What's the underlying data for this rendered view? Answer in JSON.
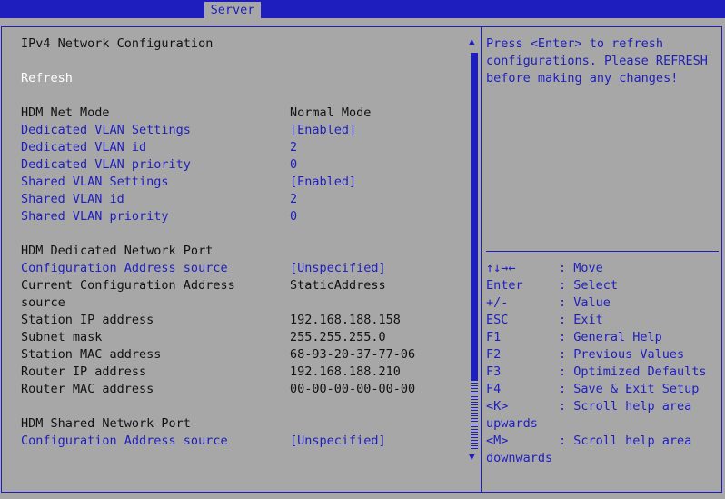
{
  "header": {
    "tab": "Server"
  },
  "page": {
    "title": "IPv4 Network Configuration",
    "refresh": "Refresh"
  },
  "settings": [
    {
      "label": "HDM Net Mode",
      "value": "Normal Mode",
      "selectable": false
    },
    {
      "label": "Dedicated VLAN Settings",
      "value": "[Enabled]",
      "selectable": true
    },
    {
      "label": "Dedicated VLAN id",
      "value": "2",
      "selectable": true
    },
    {
      "label": "Dedicated VLAN priority",
      "value": "0",
      "selectable": true
    },
    {
      "label": "Shared VLAN Settings",
      "value": "[Enabled]",
      "selectable": true
    },
    {
      "label": "Shared VLAN id",
      "value": "2",
      "selectable": true
    },
    {
      "label": "Shared VLAN priority",
      "value": "0",
      "selectable": true
    }
  ],
  "dedicated": {
    "heading": "HDM Dedicated Network Port",
    "config_source_label": "Configuration Address source",
    "config_source_value": "[Unspecified]",
    "current_label_1": "Current Configuration Address",
    "current_label_2": "source",
    "current_value": "StaticAddress",
    "rows": [
      {
        "label": "Station IP address",
        "value": "192.168.188.158"
      },
      {
        "label": "Subnet mask",
        "value": "255.255.255.0"
      },
      {
        "label": "Station MAC address",
        "value": "68-93-20-37-77-06"
      },
      {
        "label": "Router IP address",
        "value": "192.168.188.210"
      },
      {
        "label": "Router MAC address",
        "value": "00-00-00-00-00-00"
      }
    ]
  },
  "shared": {
    "heading": "HDM Shared Network Port",
    "config_source_label": "Configuration Address source",
    "config_source_value": "[Unspecified]"
  },
  "help": {
    "lines": [
      "Press <Enter> to refresh",
      "configurations. Please REFRESH",
      "before making any changes!"
    ]
  },
  "keys": [
    {
      "key": "↑↓→←",
      "desc": ": Move"
    },
    {
      "key": "Enter",
      "desc": ": Select"
    },
    {
      "key": "+/-",
      "desc": ": Value"
    },
    {
      "key": "ESC",
      "desc": ": Exit"
    },
    {
      "key": "F1",
      "desc": ": General Help"
    },
    {
      "key": "F2",
      "desc": ": Previous Values"
    },
    {
      "key": "F3",
      "desc": ": Optimized Defaults"
    },
    {
      "key": "F4",
      "desc": ": Save & Exit Setup"
    },
    {
      "key": "<K>",
      "desc": ": Scroll help area",
      "extra": "upwards"
    },
    {
      "key": "<M>",
      "desc": ": Scroll help area",
      "extra": "downwards"
    }
  ],
  "colors": {
    "background": "#a7a7a7",
    "accent": "#1e1ebe",
    "highlight": "#ffffff"
  }
}
